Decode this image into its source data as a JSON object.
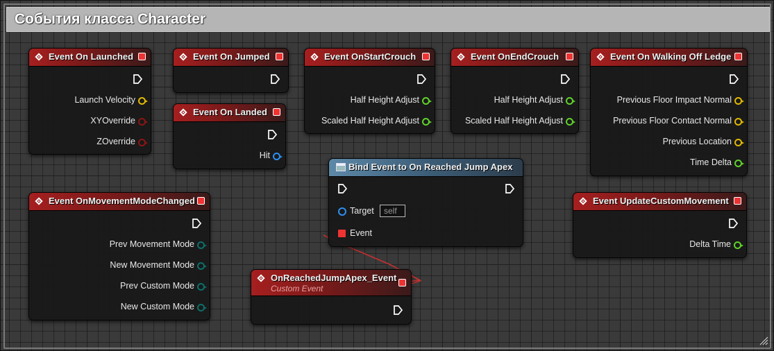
{
  "comment": {
    "title": "События класса Character"
  },
  "colors": {
    "event_header": "#a61f1f",
    "function_header": "#5d89a8",
    "pin_vector": "#e0b800",
    "pin_bool": "#8c1515",
    "pin_float": "#5fd22b",
    "pin_struct": "#2e8ff0",
    "pin_enum": "#0d6e68",
    "delegate": "#ee3333"
  },
  "nodes": {
    "on_launched": {
      "title": "Event On Launched",
      "pins": [
        "Launch Velocity",
        "XYOverride",
        "ZOverride"
      ]
    },
    "on_jumped": {
      "title": "Event On Jumped"
    },
    "on_landed": {
      "title": "Event On Landed",
      "pins": [
        "Hit"
      ]
    },
    "on_start_crouch": {
      "title": "Event OnStartCrouch",
      "pins": [
        "Half Height Adjust",
        "Scaled Half Height Adjust"
      ]
    },
    "on_end_crouch": {
      "title": "Event OnEndCrouch",
      "pins": [
        "Half Height Adjust",
        "Scaled Half Height Adjust"
      ]
    },
    "on_walking_off_ledge": {
      "title": "Event On Walking Off Ledge",
      "pins": [
        "Previous Floor Impact Normal",
        "Previous Floor Contact Normal",
        "Previous Location",
        "Time Delta"
      ]
    },
    "bind_event": {
      "title": "Bind Event to On Reached Jump Apex",
      "target_label": "Target",
      "target_value": "self",
      "event_label": "Event"
    },
    "movement_mode_changed": {
      "title": "Event OnMovementModeChanged",
      "pins": [
        "Prev Movement Mode",
        "New Movement Mode",
        "Prev Custom Mode",
        "New Custom Mode"
      ]
    },
    "update_custom_movement": {
      "title": "Event UpdateCustomMovement",
      "pins": [
        "Delta Time"
      ]
    },
    "custom_event": {
      "title": "OnReachedJumpApex_Event",
      "subtitle": "Custom Event"
    }
  }
}
